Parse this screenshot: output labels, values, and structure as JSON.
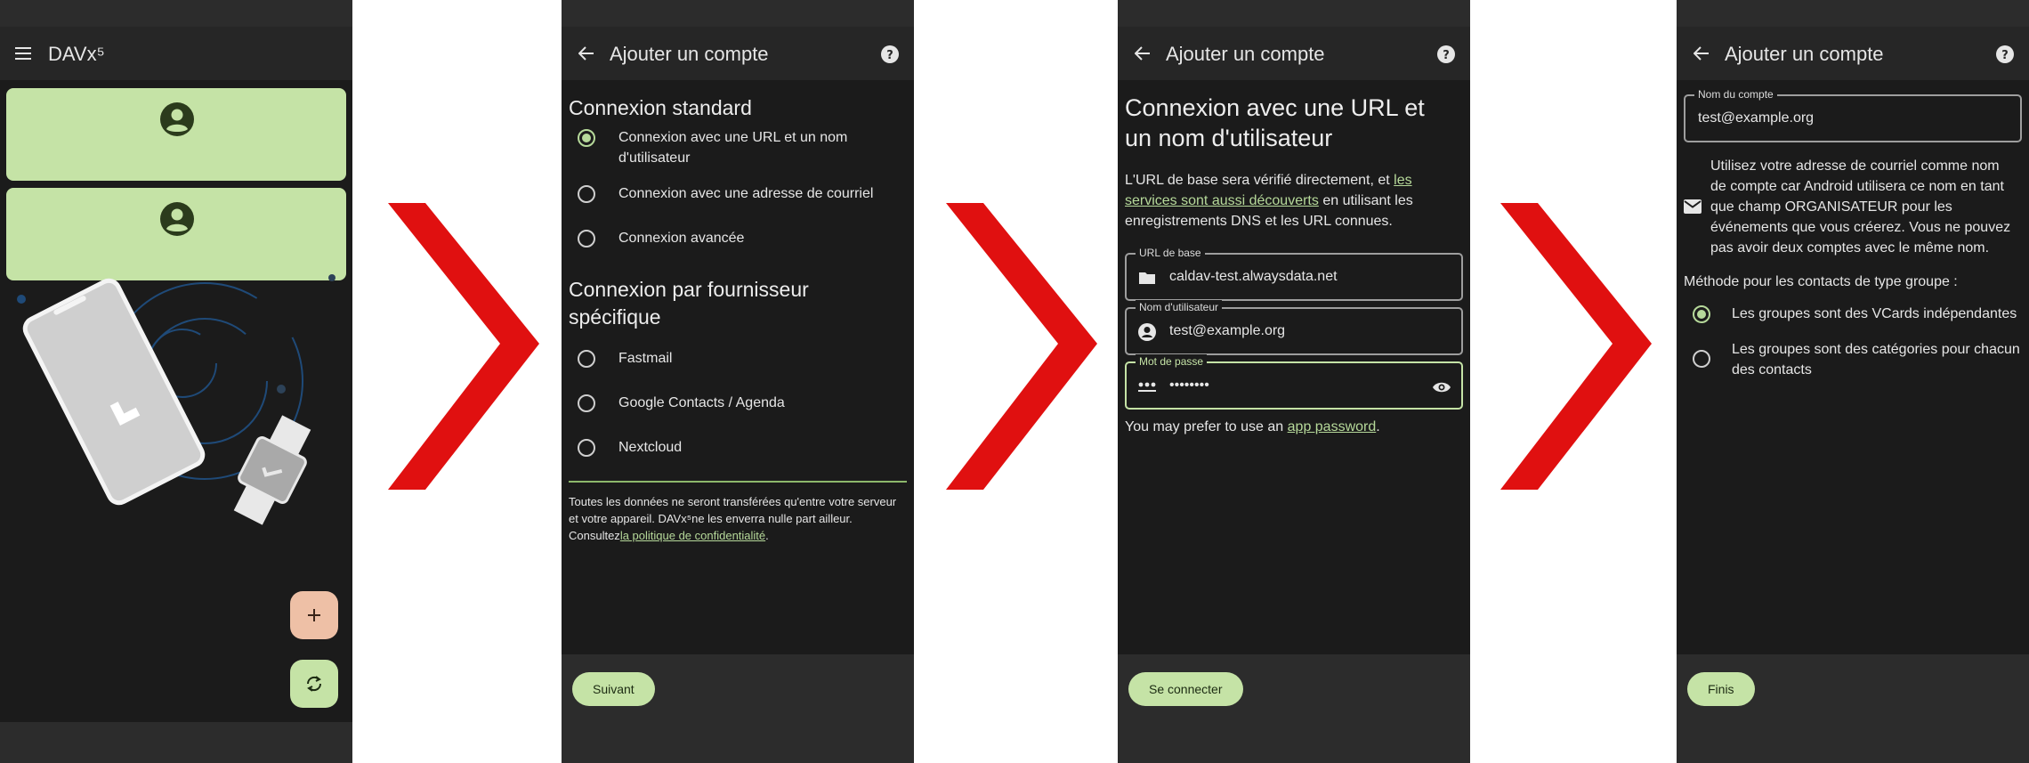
{
  "screen1": {
    "app_title": "DAVx⁵"
  },
  "screen2": {
    "title": "Ajouter un compte",
    "section_standard": "Connexion standard",
    "options_standard": [
      "Connexion avec une URL et un nom d'utilisateur",
      "Connexion avec une adresse de courriel",
      "Connexion avancée"
    ],
    "section_provider": "Connexion par fournisseur spécifique",
    "options_provider": [
      "Fastmail",
      "Google Contacts / Agenda",
      "Nextcloud"
    ],
    "privacy_text": "Toutes les données ne seront transférées qu'entre votre serveur et votre appareil. DAVx⁵ne les enverra nulle part ailleur. Consultez",
    "privacy_link": "la politique de confidentialité",
    "privacy_end": ".",
    "next_label": "Suivant"
  },
  "screen3": {
    "title": "Ajouter un compte",
    "heading": "Connexion avec une URL et un nom d'utilisateur",
    "intro_before": "L'URL de base sera vérifié directement, et ",
    "intro_link": "les services sont aussi découverts",
    "intro_after": " en utilisant les enregistrements DNS et les URL connues.",
    "base_url_label": "URL de base",
    "base_url_value": "caldav-test.alwaysdata.net",
    "username_label": "Nom d'utilisateur",
    "username_value": "test@example.org",
    "password_label": "Mot de passe",
    "password_value": "••••••••",
    "hint_before": "You may prefer to use an ",
    "hint_link": "app password",
    "hint_after": ".",
    "connect_label": "Se connecter"
  },
  "screen4": {
    "title": "Ajouter un compte",
    "account_name_label": "Nom du compte",
    "account_name_value": "test@example.org",
    "email_info": "Utilisez votre adresse de courriel comme nom de compte car Android utilisera ce nom en tant que champ ORGANISATEUR pour les événements que vous créerez. Vous ne pouvez pas avoir deux comptes avec le même nom.",
    "group_method_label": "Méthode pour les contacts de type groupe :",
    "group_options": [
      "Les groupes sont des VCards indépendantes",
      "Les groupes sont des catégories pour chacun des contacts"
    ],
    "finish_label": "Finis"
  },
  "colors": {
    "accent": "#c5e3a6",
    "arrow": "#e01010",
    "background": "#1b1b1b",
    "fab_add": "#eec0a6"
  }
}
